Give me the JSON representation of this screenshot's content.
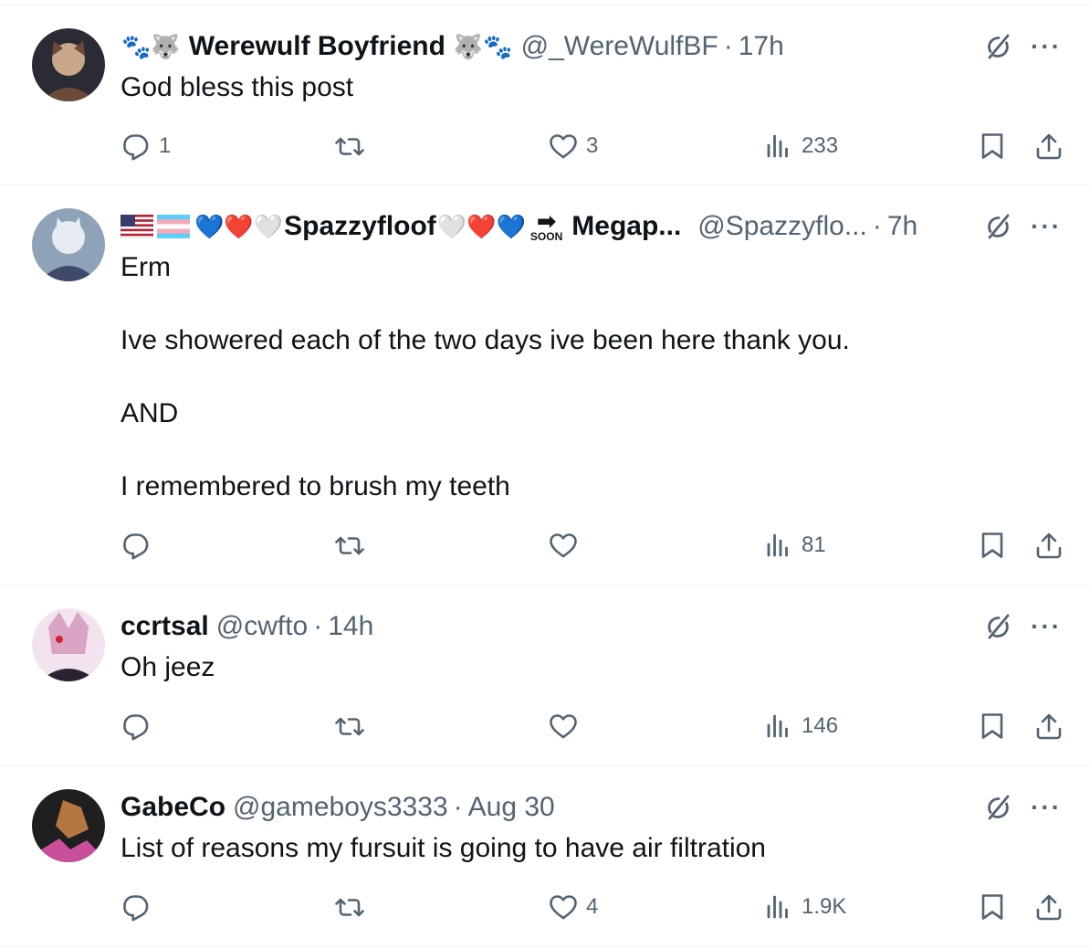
{
  "tweets": [
    {
      "name_prefix": "🐾🐺",
      "display_name": "Werewulf Boyfriend",
      "name_suffix": "🐺🐾",
      "handle": "@_WereWulfBF",
      "time": "17h",
      "text": "God bless this post",
      "replies": "1",
      "retweets": "",
      "likes": "3",
      "views": "233",
      "avatar_colors": [
        "#6b4a3a",
        "#c9a78a",
        "#2b2b35"
      ]
    },
    {
      "name_prefix": "💙❤️🤍",
      "display_name": "Spazzyfloof",
      "name_suffix": "🤍❤️💙",
      "name_extra": "Megap...",
      "soon_label": "SOON",
      "soon_arrow": "➡",
      "handle": "@Spazzyflo...",
      "time": "7h",
      "text": "Erm\n\nIve showered each of the two days ive been here thank you.\n\nAND\n\nI remembered to brush my teeth",
      "replies": "",
      "retweets": "",
      "likes": "",
      "views": "81",
      "avatar_colors": [
        "#8fa3b8",
        "#e6ecf2",
        "#3f4a6b"
      ]
    },
    {
      "display_name": "ccrtsal",
      "handle": "@cwfto",
      "time": "14h",
      "text": "Oh jeez",
      "replies": "",
      "retweets": "",
      "likes": "",
      "views": "146",
      "avatar_colors": [
        "#f3e3ee",
        "#d9a3c4",
        "#2a2230"
      ]
    },
    {
      "display_name": "GabeCo",
      "handle": "@gameboys3333",
      "time": "Aug 30",
      "text": "List of reasons my fursuit is going to have air filtration",
      "replies": "",
      "retweets": "",
      "likes": "4",
      "views": "1.9K",
      "avatar_colors": [
        "#1f1f1f",
        "#b5763f",
        "#c94f9a"
      ]
    }
  ],
  "icons": {
    "reply": "reply-icon",
    "retweet": "retweet-icon",
    "like": "heart-icon",
    "views": "views-icon",
    "bookmark": "bookmark-icon",
    "share": "share-icon",
    "grok": "grok-icon",
    "more": "more-icon"
  },
  "more_glyph": "···",
  "colors": {
    "text": "#0f1419",
    "secondary": "#536471",
    "divider": "#eff3f4"
  }
}
